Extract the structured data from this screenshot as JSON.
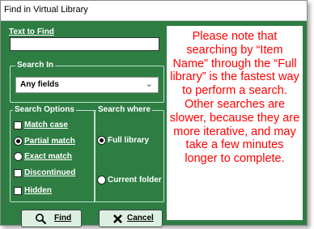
{
  "window": {
    "title": "Find in Virtual Library"
  },
  "text_to_find": {
    "label": "Text to Find",
    "value": "",
    "placeholder": ""
  },
  "search_in": {
    "legend": "Search In",
    "selected": "Any fields"
  },
  "search_options": {
    "legend": "Search Options",
    "match_case": {
      "label": "Match case",
      "checked": false
    },
    "partial_match": {
      "label": "Partial match",
      "selected": true
    },
    "exact_match": {
      "label": "Exact match",
      "selected": false
    },
    "discontinued": {
      "label": "Discontinued",
      "checked": false
    },
    "hidden": {
      "label": "Hidden",
      "checked": false
    }
  },
  "search_where": {
    "legend": "Search where",
    "full_library": {
      "label": "Full library",
      "selected": true
    },
    "current_folder": {
      "label": "Current folder",
      "selected": false
    }
  },
  "buttons": {
    "find": "Find",
    "cancel": "Cancel"
  },
  "note": "Please note that searching by “Item Name” through the “Full library” is the fastest way to perform a search. Other searches are slower, because they are more iterative, and may take a few minutes longer to complete.",
  "colors": {
    "dialog_bg": "#2e7d43",
    "note_text": "#ff0000",
    "button_bg": "#dcefe0"
  },
  "icons": {
    "find": "magnifier-icon",
    "cancel": "x-icon",
    "dropdown": "chevron-down-icon"
  }
}
